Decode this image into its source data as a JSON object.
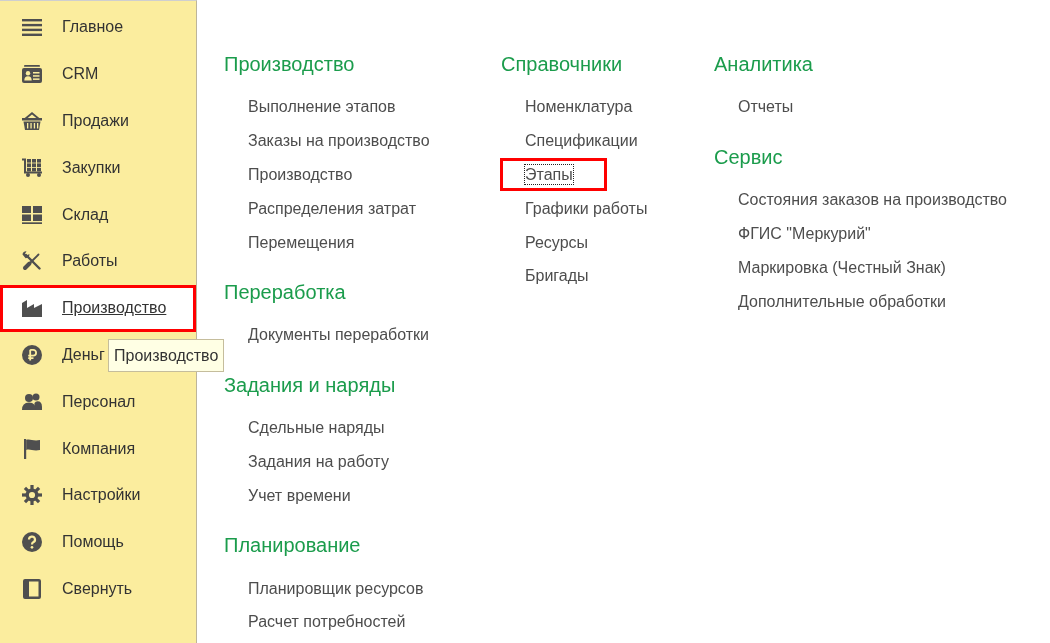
{
  "sidebar": {
    "items": [
      {
        "label": "Главное",
        "selected": false,
        "highlighted": false
      },
      {
        "label": "CRM",
        "selected": false,
        "highlighted": false
      },
      {
        "label": "Продажи",
        "selected": false,
        "highlighted": false
      },
      {
        "label": "Закупки",
        "selected": false,
        "highlighted": false
      },
      {
        "label": "Склад",
        "selected": false,
        "highlighted": false
      },
      {
        "label": "Работы",
        "selected": false,
        "highlighted": false
      },
      {
        "label": "Производство",
        "selected": true,
        "highlighted": true
      },
      {
        "label": "Деньг",
        "selected": false,
        "highlighted": false
      },
      {
        "label": "Персонал",
        "selected": false,
        "highlighted": false
      },
      {
        "label": "Компания",
        "selected": false,
        "highlighted": false
      },
      {
        "label": "Настройки",
        "selected": false,
        "highlighted": false
      },
      {
        "label": "Помощь",
        "selected": false,
        "highlighted": false
      },
      {
        "label": "Свернуть",
        "selected": false,
        "highlighted": false
      }
    ]
  },
  "tooltip": {
    "text": "Производство"
  },
  "columns": [
    {
      "groups": [
        {
          "title": "Производство",
          "links": [
            {
              "label": "Выполнение этапов",
              "focused": false,
              "highlighted": false
            },
            {
              "label": "Заказы на производство",
              "focused": false,
              "highlighted": false
            },
            {
              "label": "Производство",
              "focused": false,
              "highlighted": false
            },
            {
              "label": "Распределения затрат",
              "focused": false,
              "highlighted": false
            },
            {
              "label": "Перемещения",
              "focused": false,
              "highlighted": false
            }
          ]
        },
        {
          "title": "Переработка",
          "links": [
            {
              "label": "Документы переработки",
              "focused": false,
              "highlighted": false
            }
          ]
        },
        {
          "title": "Задания и наряды",
          "links": [
            {
              "label": "Сдельные наряды",
              "focused": false,
              "highlighted": false
            },
            {
              "label": "Задания на работу",
              "focused": false,
              "highlighted": false
            },
            {
              "label": "Учет времени",
              "focused": false,
              "highlighted": false
            }
          ]
        },
        {
          "title": "Планирование",
          "links": [
            {
              "label": "Планировщик ресурсов",
              "focused": false,
              "highlighted": false
            },
            {
              "label": "Расчет потребностей",
              "focused": false,
              "highlighted": false
            }
          ]
        }
      ]
    },
    {
      "groups": [
        {
          "title": "Справочники",
          "links": [
            {
              "label": "Номенклатура",
              "focused": false,
              "highlighted": false
            },
            {
              "label": "Спецификации",
              "focused": false,
              "highlighted": false
            },
            {
              "label": "Этапы",
              "focused": true,
              "highlighted": true
            },
            {
              "label": "Графики работы",
              "focused": false,
              "highlighted": false
            },
            {
              "label": "Ресурсы",
              "focused": false,
              "highlighted": false
            },
            {
              "label": "Бригады",
              "focused": false,
              "highlighted": false
            }
          ]
        }
      ]
    },
    {
      "groups": [
        {
          "title": "Аналитика",
          "links": [
            {
              "label": "Отчеты",
              "focused": false,
              "highlighted": false
            }
          ]
        },
        {
          "title": "Сервис",
          "links": [
            {
              "label": "Состояния заказов на производство",
              "focused": false,
              "highlighted": false
            },
            {
              "label": "ФГИС \"Меркурий\"",
              "focused": false,
              "highlighted": false
            },
            {
              "label": "Маркировка (Честный Знак)",
              "focused": false,
              "highlighted": false
            },
            {
              "label": "Дополнительные обработки",
              "focused": false,
              "highlighted": false
            }
          ]
        }
      ]
    }
  ]
}
